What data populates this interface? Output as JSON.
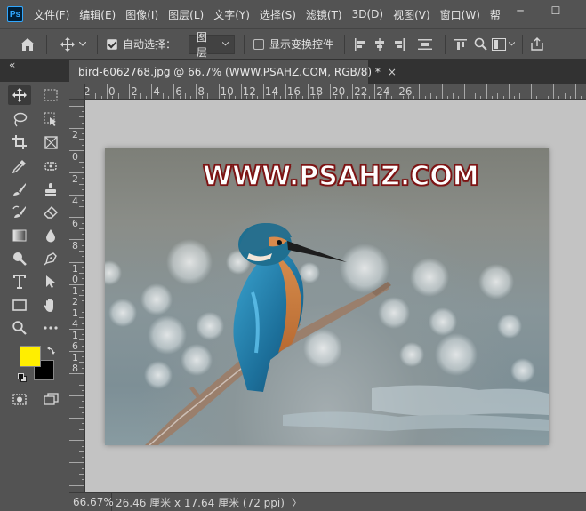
{
  "app": {
    "logo": "Ps",
    "menu": [
      "文件(F)",
      "编辑(E)",
      "图像(I)",
      "图层(L)",
      "文字(Y)",
      "选择(S)",
      "滤镜(T)",
      "3D(D)",
      "视图(V)",
      "窗口(W)",
      "帮"
    ],
    "window_controls": {
      "minimize": "─",
      "maximize": "☐"
    }
  },
  "options_bar": {
    "home_icon": "home-icon",
    "move_icon": "move-icon",
    "auto_select_label": "自动选择：",
    "auto_select_checked": true,
    "layer_select_value": "图层",
    "show_transform_label": "显示变换控件",
    "show_transform_checked": false
  },
  "panel": {
    "collapse_label": "«"
  },
  "document": {
    "tab_title": "bird-6062768.jpg @ 66.7% (WWW.PSAHZ.COM, RGB/8) *",
    "close_label": "×",
    "watermark_text": "WWW.PSAHZ.COM"
  },
  "rulers": {
    "horizontal": [
      "0",
      "2",
      "4",
      "6",
      "8",
      "10",
      "12",
      "14",
      "16",
      "18",
      "20",
      "22",
      "24",
      "26"
    ],
    "horizontal_left": "2",
    "vertical": [
      "2",
      "0",
      "2",
      "4",
      "6",
      "8",
      "1\n0",
      "1\n2",
      "1\n4",
      "1\n6",
      "1\n8"
    ]
  },
  "colors": {
    "foreground": "#ffee00",
    "background": "#000000",
    "watermark_outline": "#7d1414",
    "canvas_bg": "#c3c3c3"
  },
  "status": {
    "zoom": "66.67%",
    "doc_info": "26.46 厘米 x 17.64 厘米 (72 ppi)",
    "arrow": "〉"
  }
}
